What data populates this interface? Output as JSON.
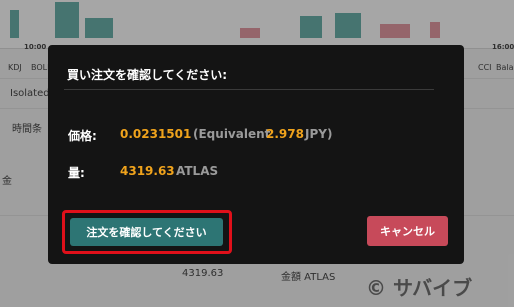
{
  "background": {
    "chart_times": [
      "10:00",
      "16:00"
    ],
    "indicators_left": [
      "KDJ",
      "BOLL"
    ],
    "indicators_right": [
      "CCI",
      "Bala"
    ],
    "isolated": "Isolated",
    "time_label": "時間条",
    "fund_label": "金",
    "amount_value": "4319.63",
    "total_label": "金額 ATLAS"
  },
  "modal": {
    "title": "買い注文を確認してください:",
    "price_label": "価格:",
    "price_value": "0.0231501",
    "equiv_prefix": "(Equivalent",
    "equiv_value": "2.978",
    "equiv_suffix": "JPY)",
    "qty_label": "量:",
    "qty_value": "4319.63",
    "qty_unit": "ATLAS",
    "confirm_label": "注文を確認してください",
    "cancel_label": "キャンセル"
  },
  "watermark": "© サバイブ",
  "colors": {
    "accent": "#f0a31c",
    "confirm_bg": "#2d7574",
    "cancel_bg": "#c74a5a",
    "highlight": "#e0101a",
    "modal_bg": "#141414"
  }
}
